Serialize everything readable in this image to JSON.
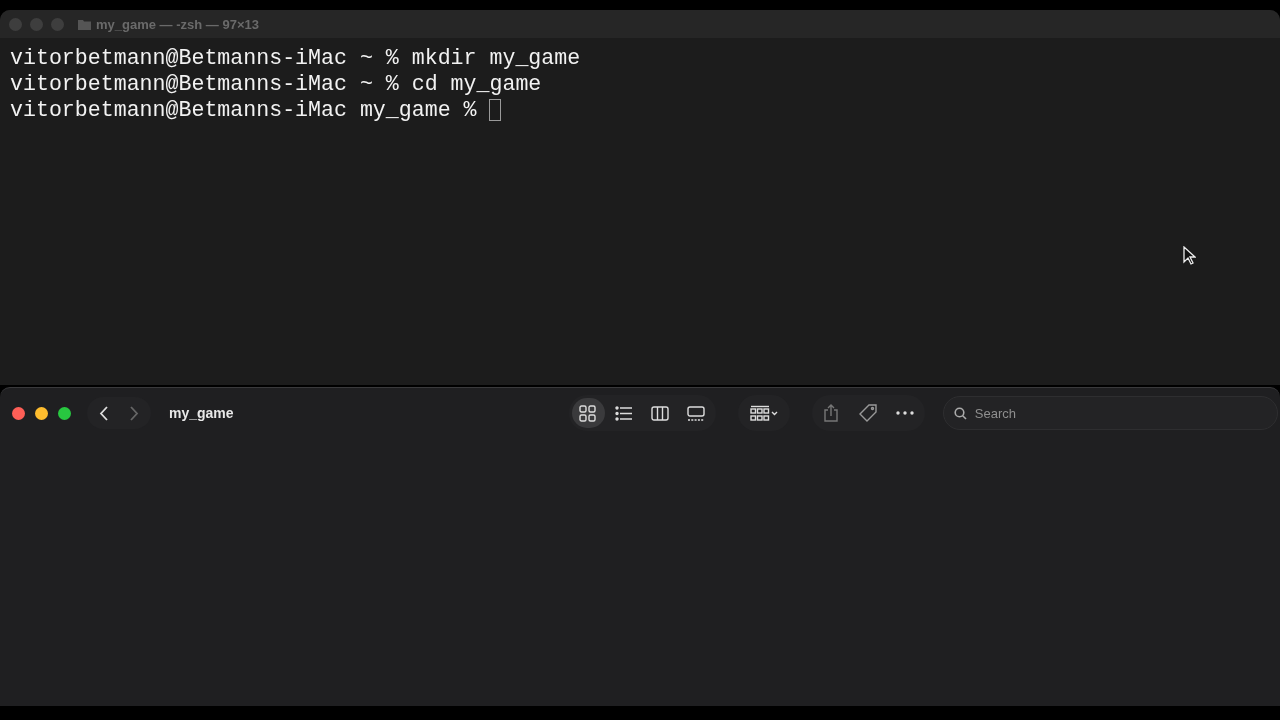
{
  "terminal": {
    "title": "my_game — -zsh — 97×13",
    "lines": [
      {
        "text": "vitorbetmann@Betmanns-iMac ~ % mkdir my_game",
        "cursor": false
      },
      {
        "text": "vitorbetmann@Betmanns-iMac ~ % cd my_game",
        "cursor": false
      },
      {
        "text": "vitorbetmann@Betmanns-iMac my_game % ",
        "cursor": true
      }
    ]
  },
  "finder": {
    "title": "my_game",
    "nav": [
      {
        "kind": "back",
        "disabled": false
      },
      {
        "kind": "forward",
        "disabled": true
      }
    ],
    "views": [
      {
        "kind": "icons",
        "selected": true
      },
      {
        "kind": "list",
        "selected": false
      },
      {
        "kind": "columns",
        "selected": false
      },
      {
        "kind": "gallery",
        "selected": false
      }
    ],
    "search": {
      "placeholder": "Search"
    }
  }
}
